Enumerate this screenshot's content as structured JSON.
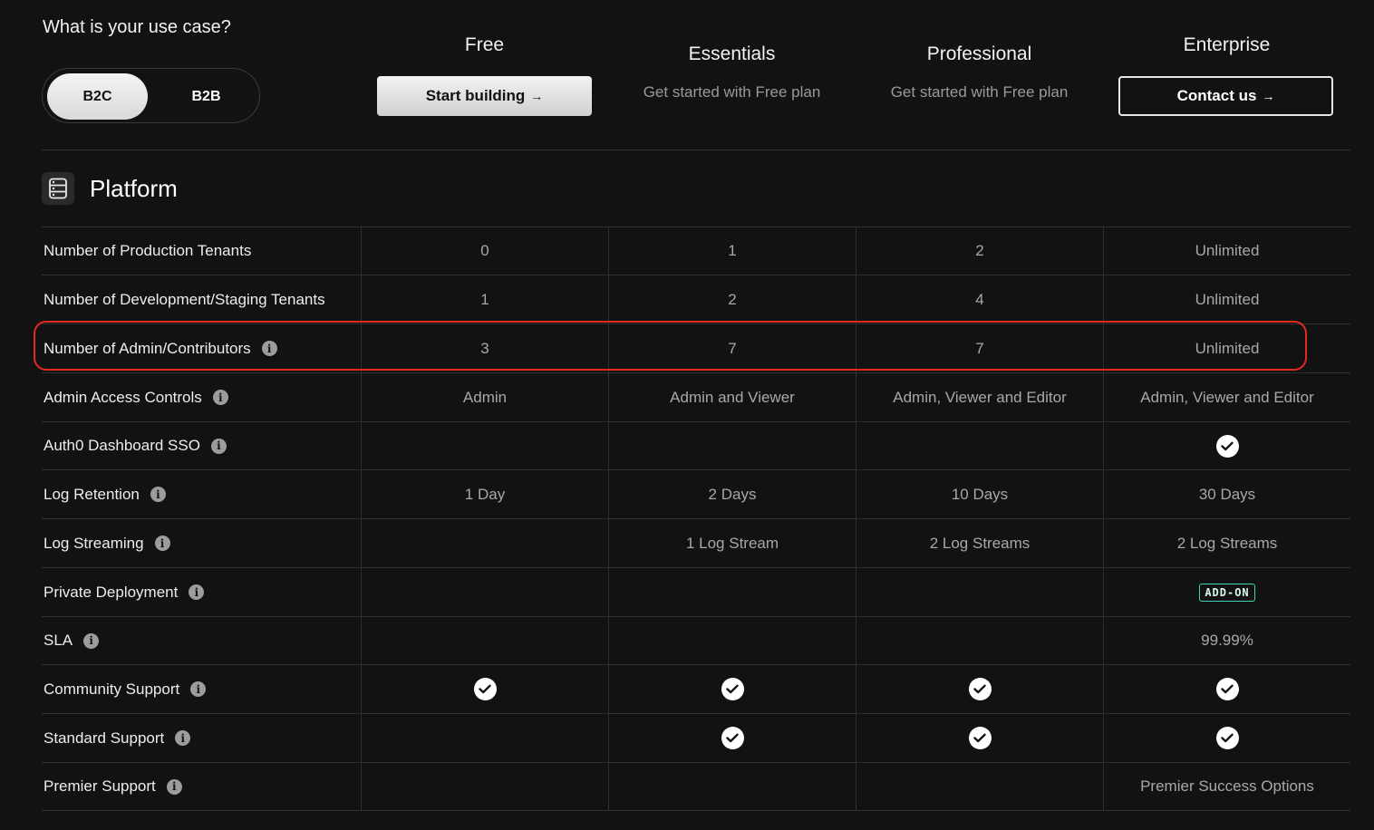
{
  "header": {
    "use_case_title": "What is your use case?",
    "toggle": {
      "option_b2c": "B2C",
      "option_b2b": "B2B",
      "selected": "B2C"
    }
  },
  "plans": [
    {
      "name": "Free",
      "button_label": "Start building",
      "arrow": "→"
    },
    {
      "name": "Essentials",
      "subtitle": "Get started with Free plan"
    },
    {
      "name": "Professional",
      "subtitle": "Get started with Free plan"
    },
    {
      "name": "Enterprise",
      "button_label": "Contact us",
      "arrow": "→"
    }
  ],
  "section": {
    "title": "Platform",
    "icon": "server-rack-icon"
  },
  "rows": [
    {
      "label": "Number of Production Tenants",
      "info": false,
      "values": [
        "0",
        "1",
        "2",
        "Unlimited"
      ]
    },
    {
      "label": "Number of Development/Staging Tenants",
      "info": false,
      "values": [
        "1",
        "2",
        "4",
        "Unlimited"
      ]
    },
    {
      "label": "Number of Admin/Contributors",
      "info": true,
      "values": [
        "3",
        "7",
        "7",
        "Unlimited"
      ],
      "highlighted": true
    },
    {
      "label": "Admin Access Controls",
      "info": true,
      "values": [
        "Admin",
        "Admin and Viewer",
        "Admin, Viewer and Editor",
        "Admin, Viewer and Editor"
      ]
    },
    {
      "label": "Auth0 Dashboard SSO",
      "info": true,
      "values": [
        "",
        "",
        "",
        "check"
      ]
    },
    {
      "label": "Log Retention",
      "info": true,
      "values": [
        "1 Day",
        "2 Days",
        "10 Days",
        "30 Days"
      ]
    },
    {
      "label": "Log Streaming",
      "info": true,
      "values": [
        "",
        "1 Log Stream",
        "2 Log Streams",
        "2 Log Streams"
      ]
    },
    {
      "label": "Private Deployment",
      "info": true,
      "values": [
        "",
        "",
        "",
        "badge:ADD-ON"
      ]
    },
    {
      "label": "SLA",
      "info": true,
      "values": [
        "",
        "",
        "",
        "99.99%"
      ]
    },
    {
      "label": "Community Support",
      "info": true,
      "values": [
        "check",
        "check",
        "check",
        "check"
      ]
    },
    {
      "label": "Standard Support",
      "info": true,
      "values": [
        "",
        "check",
        "check",
        "check"
      ]
    },
    {
      "label": "Premier Support",
      "info": true,
      "values": [
        "",
        "",
        "",
        "Premier Success Options"
      ]
    }
  ],
  "icons": {
    "info": "info-icon",
    "check": "check-circle-icon"
  },
  "colors": {
    "background": "#121212",
    "highlight": "#e32a20",
    "addon": "#3fd3b3"
  }
}
